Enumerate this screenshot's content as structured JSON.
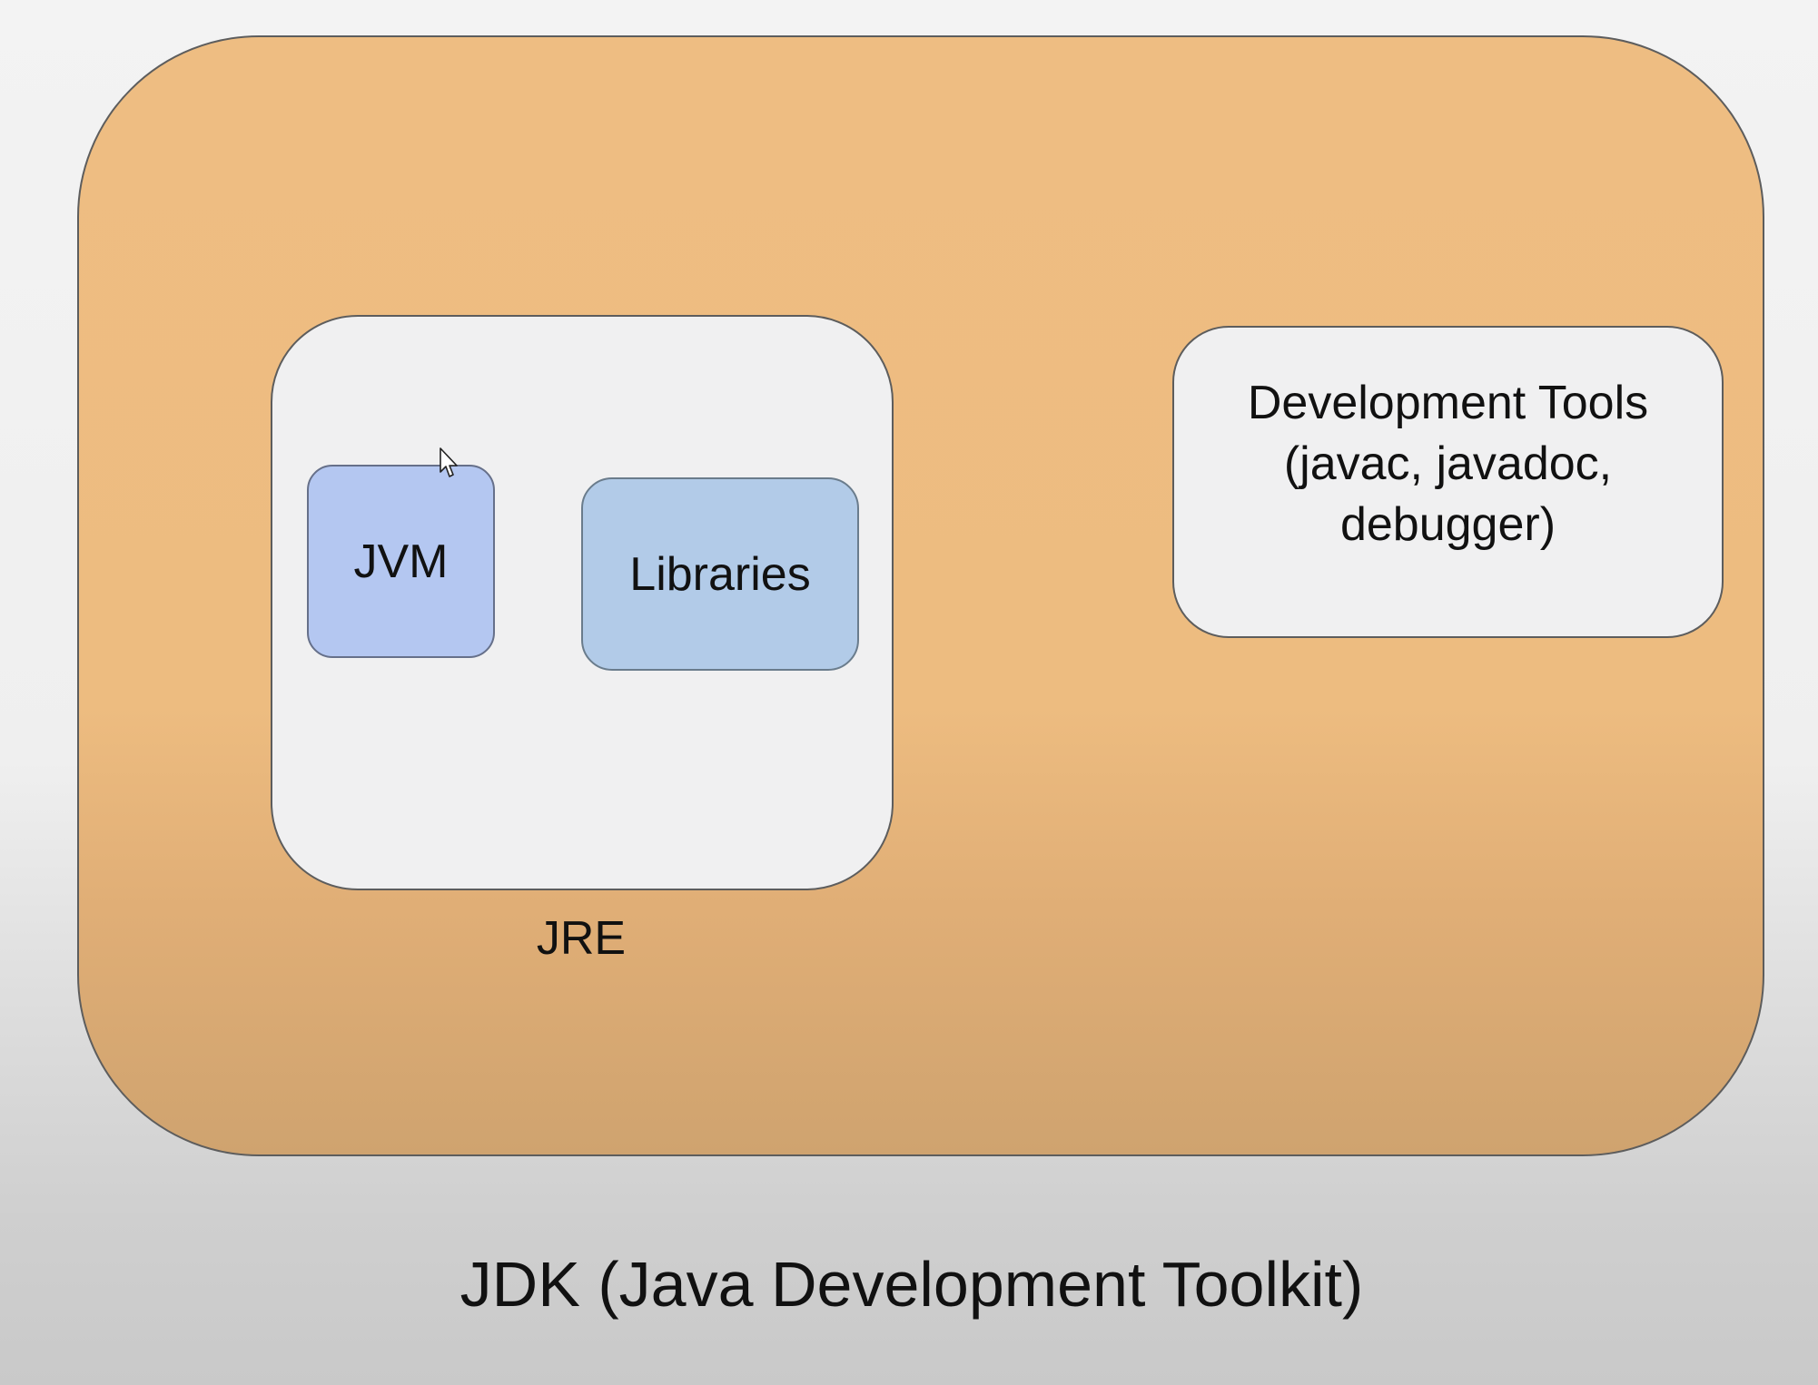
{
  "diagram": {
    "outer_box": {
      "label": "JDK (Java Development Toolkit)"
    },
    "jre_box": {
      "label": "JRE",
      "components": [
        {
          "label": "JVM"
        },
        {
          "label": "Libraries"
        }
      ]
    },
    "tools_box": {
      "label": "Development Tools\n(javac, javadoc,\ndebugger)"
    }
  },
  "colors": {
    "jdk_fill": "#edbc80",
    "jre_fill": "#f0f0f1",
    "jvm_fill": "#b4c7f1",
    "libraries_fill": "#b2cbe8",
    "tools_fill": "#f0f0f1"
  },
  "icons": {
    "cursor": "mouse-pointer-icon"
  }
}
